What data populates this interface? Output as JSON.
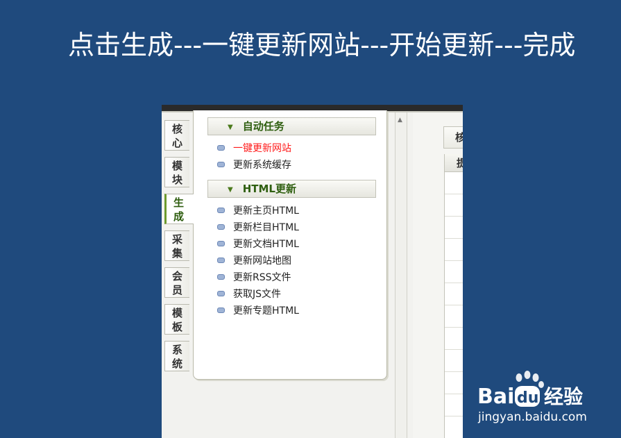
{
  "slide": {
    "title": "点击生成---一键更新网站---开始更新---完成"
  },
  "vertical_tabs": [
    {
      "char1": "核",
      "char2": "心",
      "active": false
    },
    {
      "char1": "模",
      "char2": "块",
      "active": false
    },
    {
      "char1": "生",
      "char2": "成",
      "active": true
    },
    {
      "char1": "采",
      "char2": "集",
      "active": false
    },
    {
      "char1": "会",
      "char2": "员",
      "active": false
    },
    {
      "char1": "模",
      "char2": "板",
      "active": false
    },
    {
      "char1": "系",
      "char2": "统",
      "active": false
    }
  ],
  "menu": {
    "section1": {
      "title": "自动任务",
      "items": [
        {
          "label": "一键更新网站",
          "highlight": true
        },
        {
          "label": "更新系统缓存",
          "highlight": false
        }
      ]
    },
    "section2": {
      "title": "HTML更新",
      "items": [
        {
          "label": "更新主页HTML"
        },
        {
          "label": "更新栏目HTML"
        },
        {
          "label": "更新文档HTML"
        },
        {
          "label": "更新网站地图"
        },
        {
          "label": "更新RSS文件"
        },
        {
          "label": "获取JS文件"
        },
        {
          "label": "更新专题HTML"
        }
      ]
    }
  },
  "right_pane": {
    "tab_label": "核",
    "table_head_char": "提"
  },
  "watermark": {
    "brand_left": "Bai",
    "brand_right": "du",
    "brand_cn": "经验",
    "url": "jingyan.baidu.com"
  },
  "colors": {
    "background": "#1f4a7d",
    "highlight_text": "#ff1a1a",
    "header_text": "#2f5f10"
  },
  "icons": {
    "section_chevron": "chevron-down-icon",
    "menu_bullet": "bullet-icon",
    "scroll_up": "scroll-up-arrow-icon",
    "watermark_paw": "baidu-paw-icon"
  }
}
